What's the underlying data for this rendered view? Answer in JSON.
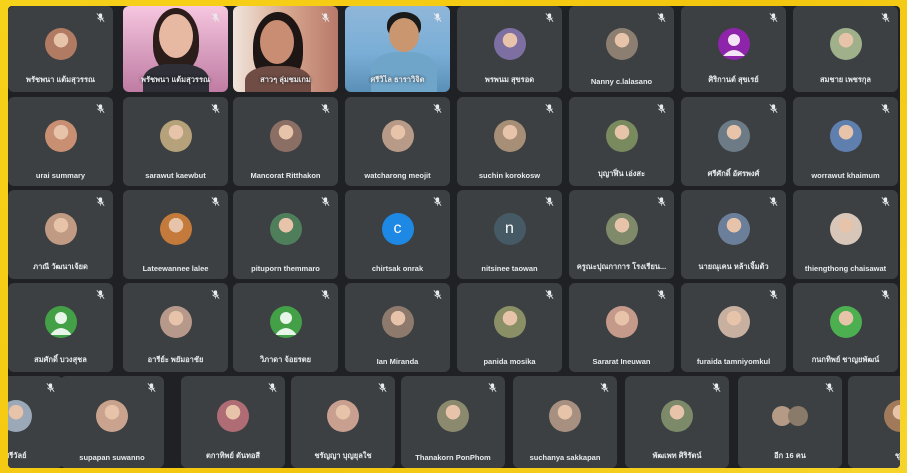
{
  "meeting": {
    "participants": [
      {
        "name": "พรัชพนา แต้มสุวรรณ",
        "type": "photo",
        "color": "#b07a63"
      },
      {
        "name": "พรัชพนา แต้มสุวรรณ",
        "type": "video",
        "color": "#e6b0cd"
      },
      {
        "name": "สาวๆ ลุ่มชมเกม",
        "type": "video",
        "color": "#d7a48c"
      },
      {
        "name": "ศรีวิไล ธาราวิจิต",
        "type": "video",
        "color": "#7aaed6"
      },
      {
        "name": "พรพนม สุขรอด",
        "type": "photo",
        "color": "#7e6fa3"
      },
      {
        "name": "Nanny c.lalasano",
        "type": "photo",
        "color": "#8c7f72"
      },
      {
        "name": "ศิริกานต์ สุขเรย์",
        "type": "initial",
        "initial": "",
        "color": "#8e24aa"
      },
      {
        "name": "สมชาย เพชรกุล",
        "type": "photo",
        "color": "#9fb08b"
      },
      {
        "name": "urai summary",
        "type": "photo",
        "color": "#c98f72"
      },
      {
        "name": "sarawut kaewbut",
        "type": "photo",
        "color": "#b5a27a"
      },
      {
        "name": "Mancorat Ritthakon",
        "type": "photo",
        "color": "#8b6f65"
      },
      {
        "name": "watcharong meojit",
        "type": "photo",
        "color": "#b89a88"
      },
      {
        "name": "suchin korokosw",
        "type": "photo",
        "color": "#a68e77"
      },
      {
        "name": "บุญาฬิ่น เอ่งสะ",
        "type": "photo",
        "color": "#7a8a5f"
      },
      {
        "name": "ศรีศักดิ์ อัศรพงศ์",
        "type": "photo",
        "color": "#6d7b86"
      },
      {
        "name": "worrawut khaimum",
        "type": "photo",
        "color": "#5f7fae"
      },
      {
        "name": "ภาณี วัฒนาเจ้ยด",
        "type": "photo",
        "color": "#c09a82"
      },
      {
        "name": "Lateewannee lalee",
        "type": "photo",
        "color": "#c47a3a"
      },
      {
        "name": "pituporn themmaro",
        "type": "photo",
        "color": "#4f7f5a"
      },
      {
        "name": "chirtsak onrak",
        "type": "initial",
        "initial": "c",
        "color": "#1e88e5"
      },
      {
        "name": "nitsinee taowan",
        "type": "initial",
        "initial": "n",
        "color": "#455a64"
      },
      {
        "name": "ครูณะปุณกาการ โรงเรียน...",
        "type": "photo",
        "color": "#7f8a6a"
      },
      {
        "name": "นายณุเคน หล้าเจิ้มต้ว",
        "type": "photo",
        "color": "#6b7f9a"
      },
      {
        "name": "thiengthong chaisawat",
        "type": "photo",
        "color": "#d8c7b8"
      },
      {
        "name": "สมศักดิ์ บวงสุชล",
        "type": "default",
        "color": "#43a047"
      },
      {
        "name": "อารีย์ะ พยัมอาชัย",
        "type": "photo",
        "color": "#b6998a"
      },
      {
        "name": "วิภาดา จ้อยรตย",
        "type": "default",
        "color": "#43a047"
      },
      {
        "name": "Ian Miranda",
        "type": "photo",
        "color": "#8e7a6c"
      },
      {
        "name": "panida mosika",
        "type": "photo",
        "color": "#8a8f66"
      },
      {
        "name": "Sararat Ineuwan",
        "type": "photo",
        "color": "#c69a8b"
      },
      {
        "name": "furaida tamniyomkul",
        "type": "photo",
        "color": "#c7b0a0"
      },
      {
        "name": "กนกทิพย์ ชาญยพัฒน์",
        "type": "photo",
        "color": "#4caf50"
      },
      {
        "name": "ศรีวัลย์",
        "type": "photo",
        "color": "#9aa8b8"
      },
      {
        "name": "supapan suwanno",
        "type": "photo",
        "color": "#caa38f"
      },
      {
        "name": "ตกาทิพย์ ตันทอสี",
        "type": "photo",
        "color": "#b06c74"
      },
      {
        "name": "ชรัญญา บุญยุลใช",
        "type": "photo",
        "color": "#c9a08f"
      },
      {
        "name": "Thanakorn PonPhom",
        "type": "photo",
        "color": "#8c8a6e"
      },
      {
        "name": "suchanya sakkapan",
        "type": "photo",
        "color": "#a89080"
      },
      {
        "name": "พัฒเพท ศิริรัตน์",
        "type": "photo",
        "color": "#7c8a6a"
      },
      {
        "name": "อีก 16 คน",
        "type": "group",
        "color": "#8a7a6a"
      },
      {
        "name": "ชุม",
        "type": "photo",
        "color": "#a07a5a"
      }
    ]
  }
}
